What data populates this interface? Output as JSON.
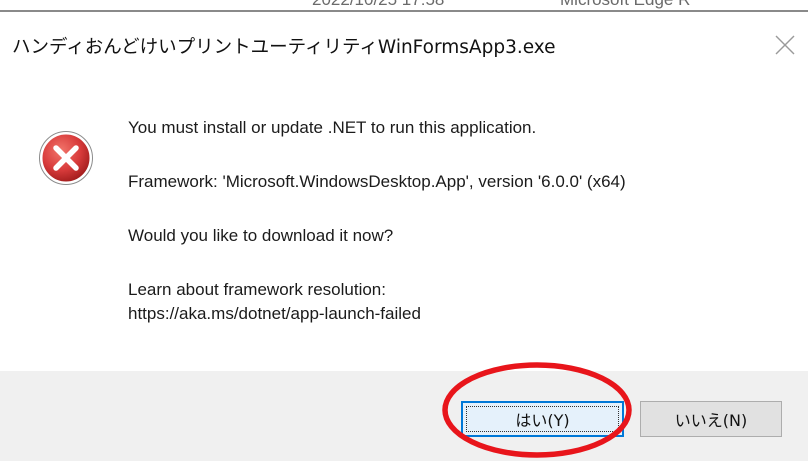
{
  "background_window": {
    "date_fragment": "2022/10/25 17:58",
    "app_fragment": "Microsoft Edge R"
  },
  "dialog": {
    "title": "ハンディおんどけいプリントユーティリティWinFormsApp3.exe",
    "close_label": "✕",
    "icon": "error-icon",
    "messages": {
      "line1": "You must install or update .NET to run this application.",
      "line2": "Framework: 'Microsoft.WindowsDesktop.App', version '6.0.0' (x64)",
      "line3": "Would you like to download it now?",
      "line4": "Learn about framework resolution:",
      "line5": "https://aka.ms/dotnet/app-launch-failed"
    },
    "buttons": {
      "yes": "はい(Y)",
      "no": "いいえ(N)"
    }
  },
  "colors": {
    "annotation_circle": "#e8151b",
    "error_icon_fill": "#d83b3b",
    "button_focus": "#0078d7",
    "footer_bg": "#f0f0f0"
  }
}
